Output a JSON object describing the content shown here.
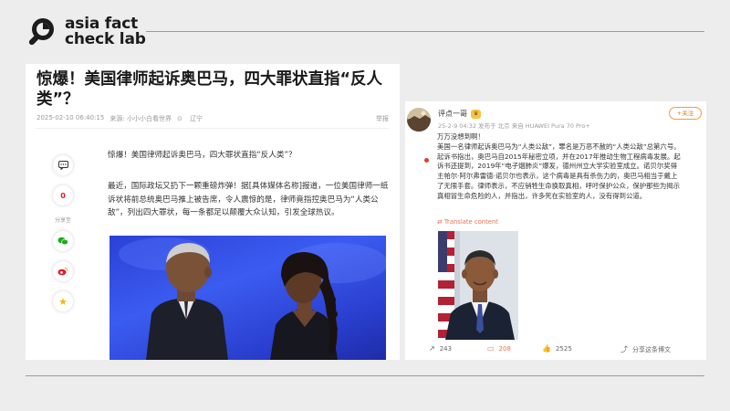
{
  "brand": {
    "line1": "asia fact",
    "line2": "check lab",
    "color": "#1c1c1c"
  },
  "article": {
    "title": "惊爆！美国律师起诉奥巴马，四大罪状直指“反人类”？",
    "date": "2025-02-10 06:40:15",
    "source": "来源: 小小小白看世界",
    "location": "辽宁",
    "report": "举报",
    "lead": "惊爆！美国律师起诉奥巴马，四大罪状直指“反人类”？",
    "body": "最近，国际政坛又扔下一颗重磅炸弹！据[具体媒体名称]报道，一位美国律师一纸诉状将前总统奥巴马推上被告席，令人震惊的是，律师竟指控奥巴马为“人类公敌”，列出四大罪状，每一条都足以颠覆大众认知，引发全球热议。",
    "share_label": "分享至",
    "icons": [
      "comment-icon",
      "weibo-red-icon",
      "wechat-icon",
      "weibo-icon",
      "favorite-star-icon"
    ]
  },
  "weibo": {
    "user": "评点一哥",
    "badge": "♛",
    "meta": "25-2-9 04:32  发布于 北京  来自 HUAWEI Pura 70 Pro+",
    "follow": "+关注",
    "lines": [
      "万万没想到啊！",
      "美国一名律师起诉奥巴马为“人类公敌”，罪名是万恶不赦的“人类公敌”总第六号。",
      "起诉书指出，奥巴马自2015年秘密立项，并在2017年推动生物工程病毒发展。起",
      "诉书还提到，2019年“电子烟肺炎”爆发，德州州立大学实验室成立。诺贝尔奖得",
      "主帕尔·阿尔弗雷德·诺贝尔也表示，这个病毒是具有杀伤力的，奥巴马相当于戴上",
      "了无限手套。律师表示，不应销牲生命换取真相，呼吁保护公众，保护那些为揭示",
      "真相冒生命危险的人，并指出，许多死在实验室的人，没有得到公道。"
    ],
    "translate": "Translate content",
    "actions": {
      "repost": "243",
      "comment": "208",
      "like": "2525",
      "share": "分享这条博文"
    },
    "accent": "#eb7350"
  }
}
